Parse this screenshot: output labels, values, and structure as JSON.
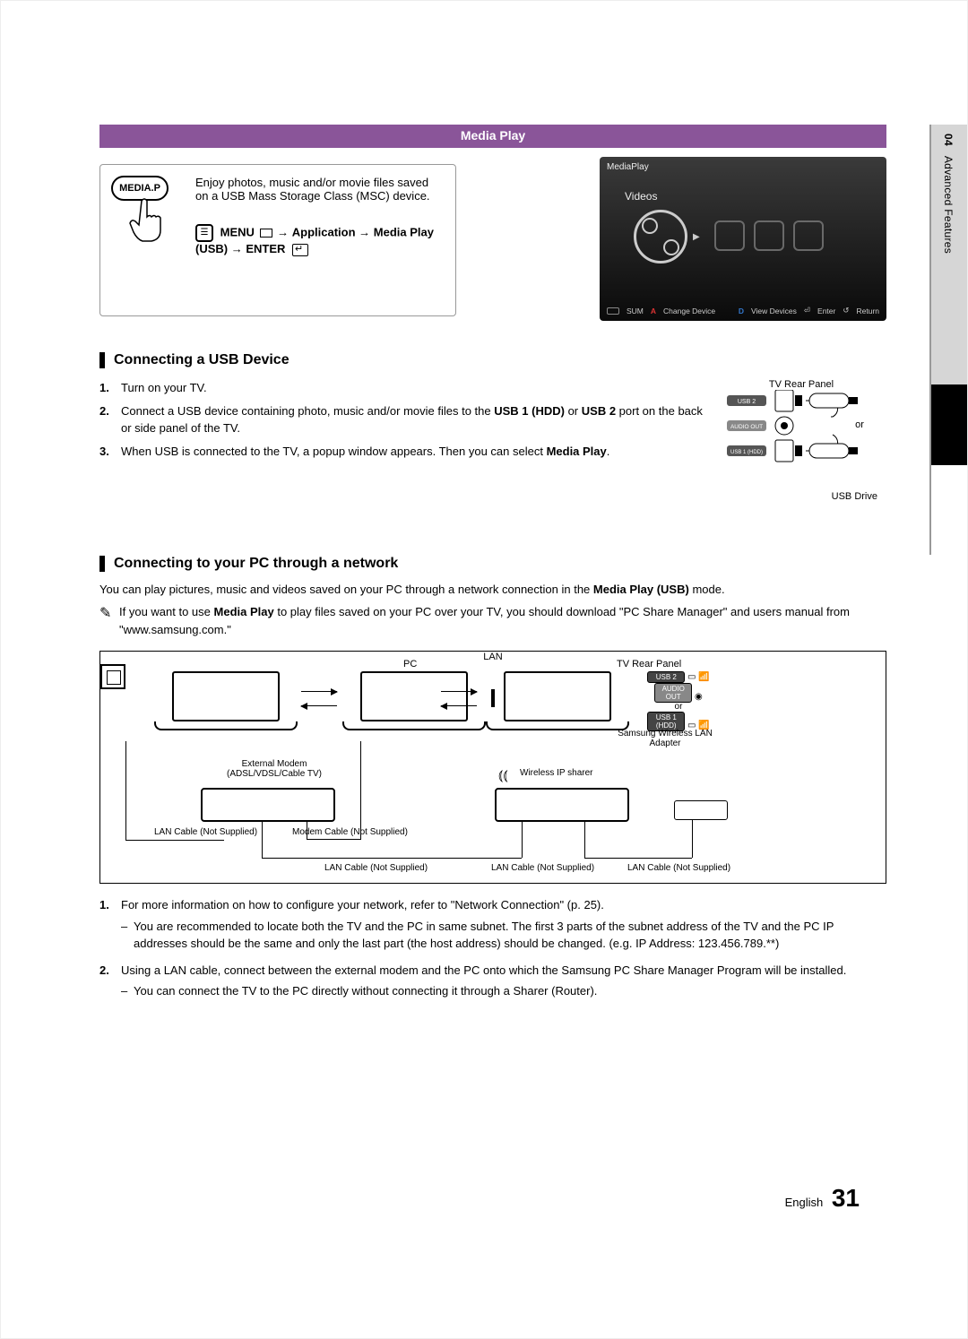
{
  "sideTab": {
    "chapter": "04",
    "section": "Advanced Features"
  },
  "header": {
    "title": "Media Play"
  },
  "intro": {
    "remoteButton": "MEDIA.P",
    "desc": "Enjoy photos, music and/or movie files saved on a USB Mass Storage Class (MSC) device.",
    "menu": {
      "prefix": "MENU",
      "p1": "Application",
      "p2": "Media Play (USB)",
      "p3": "ENTER"
    }
  },
  "tvshot": {
    "title": "MediaPlay",
    "tab": "Videos",
    "footerLeft1": "SUM",
    "footerLeftA": "A",
    "footerLeft2": "Change Device",
    "footerRightD": "D",
    "footerRight1": "View Devices",
    "footerRight2": "Enter",
    "footerRight3": "Return"
  },
  "usb": {
    "title": "Connecting a USB Device",
    "steps": [
      "Turn on your TV.",
      "Connect a USB device containing photo, music and/or movie files to the <b>USB 1 (HDD)</b> or <b>USB 2</b> port on the back or side panel of the TV.",
      "When USB is connected to the TV, a popup window appears. Then you can select <b>Media Play</b>."
    ],
    "figure": {
      "panel": "TV Rear Panel",
      "port1": "USB 2",
      "portA": "AUDIO OUT",
      "port2": "USB 1 (HDD)",
      "or": "or",
      "drive": "USB Drive"
    }
  },
  "network": {
    "title": "Connecting to your PC through a network",
    "intro": "You can play pictures, music and videos saved on your PC through a network connection in the <b>Media Play (USB)</b> mode.",
    "note": "If you want to use <b>Media Play</b> to play files saved on your PC over your TV, you should download \"PC Share Manager\" and users manual from \"www.samsung.com.\"",
    "diagram": {
      "lan": "LAN",
      "pc": "PC",
      "tvPanel": "TV Rear Panel",
      "or": "or",
      "adapter": "Samsung Wireless LAN Adapter",
      "modem": "External Modem",
      "modemSub": "(ADSL/VDSL/Cable TV)",
      "router": "Wireless IP sharer",
      "cableLan": "LAN Cable (Not Supplied)",
      "cableModem": "Modem Cable (Not Supplied)"
    },
    "steps": [
      {
        "text": "For more information on how to configure your network, refer to \"Network Connection\" (p. 25).",
        "subs": [
          "You are recommended to locate both the TV and the PC in same subnet. The first 3 parts of the subnet address of the TV and the PC IP addresses should be the same and only the last part (the host address) should be changed. (e.g. IP Address: 123.456.789.**)"
        ]
      },
      {
        "text": "Using a LAN cable, connect between the external modem and the PC onto which the Samsung PC Share Manager Program will be installed.",
        "subs": [
          "You can connect the TV to the PC directly without connecting it through a Sharer (Router)."
        ]
      }
    ]
  },
  "footer": {
    "lang": "English",
    "page": "31"
  }
}
